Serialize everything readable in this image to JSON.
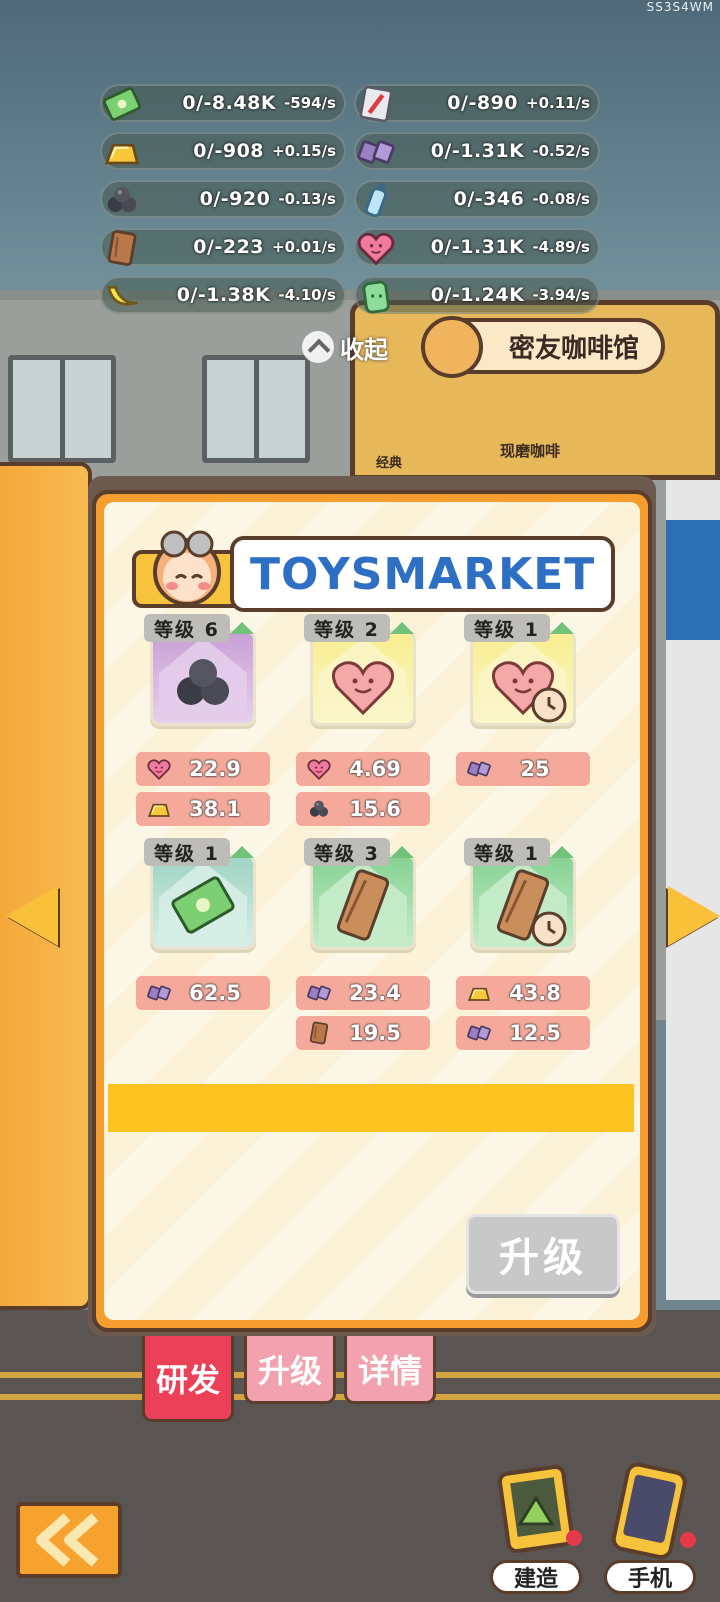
{
  "watermark": "SS3S4WM",
  "resources_left": [
    {
      "icon": "cash-bundle-icon",
      "amount": "0/-8.48K",
      "rate": "-594/s"
    },
    {
      "icon": "gold-bar-icon",
      "amount": "0/-908",
      "rate": "+0.15/s"
    },
    {
      "icon": "coal-icon",
      "amount": "0/-920",
      "rate": "-0.13/s"
    },
    {
      "icon": "wood-plank-icon",
      "amount": "0/-223",
      "rate": "+0.01/s"
    },
    {
      "icon": "banana-icon",
      "amount": "0/-1.38K",
      "rate": "-4.10/s"
    }
  ],
  "resources_right": [
    {
      "icon": "rocket-card-icon",
      "amount": "0/-890",
      "rate": "+0.11/s"
    },
    {
      "icon": "iron-bar-icon",
      "amount": "0/-1.31K",
      "rate": "-0.52/s"
    },
    {
      "icon": "water-bottle-icon",
      "amount": "0/-346",
      "rate": "-0.08/s"
    },
    {
      "icon": "heart-icon",
      "amount": "0/-1.31K",
      "rate": "-4.89/s"
    },
    {
      "icon": "jar-icon",
      "amount": "0/-1.24K",
      "rate": "-3.94/s"
    }
  ],
  "collapse_label": "收起",
  "shop": {
    "name": "密友咖啡馆",
    "menu_1": "经典",
    "menu_2": "现磨咖啡",
    "bg_sign": "TOYSMARKET"
  },
  "panel_title": "TOYSMARKET",
  "cards": [
    {
      "level": "等级 6",
      "item": "coal",
      "reqs": [
        {
          "icon": "heart-icon",
          "value": "22.9"
        },
        {
          "icon": "gold-bar-icon",
          "value": "38.1"
        }
      ]
    },
    {
      "level": "等级 2",
      "item": "heart",
      "reqs": [
        {
          "icon": "heart-icon",
          "value": "4.69"
        },
        {
          "icon": "coal-icon",
          "value": "15.6"
        }
      ]
    },
    {
      "level": "等级 1",
      "item": "heart-timer",
      "reqs": [
        {
          "icon": "iron-bar-icon",
          "value": "25"
        }
      ]
    },
    {
      "level": "等级 1",
      "item": "cash",
      "reqs": [
        {
          "icon": "iron-bar-icon",
          "value": "62.5"
        }
      ]
    },
    {
      "level": "等级 3",
      "item": "wood",
      "reqs": [
        {
          "icon": "iron-bar-icon",
          "value": "23.4"
        },
        {
          "icon": "wood-plank-icon",
          "value": "19.5"
        }
      ]
    },
    {
      "level": "等级 1",
      "item": "wood-timer",
      "reqs": [
        {
          "icon": "gold-bar-icon",
          "value": "43.8"
        },
        {
          "icon": "iron-bar-icon",
          "value": "12.5"
        }
      ]
    }
  ],
  "upgrade_button": "升级",
  "tabs": [
    "研发",
    "升级",
    "详情"
  ],
  "bottom": {
    "build": "建造",
    "phone": "手机"
  },
  "colors": {
    "accent": "#ec4058",
    "page": "#fbf2d8",
    "frame": "#f59d2f",
    "highlight": "#fbc320"
  }
}
